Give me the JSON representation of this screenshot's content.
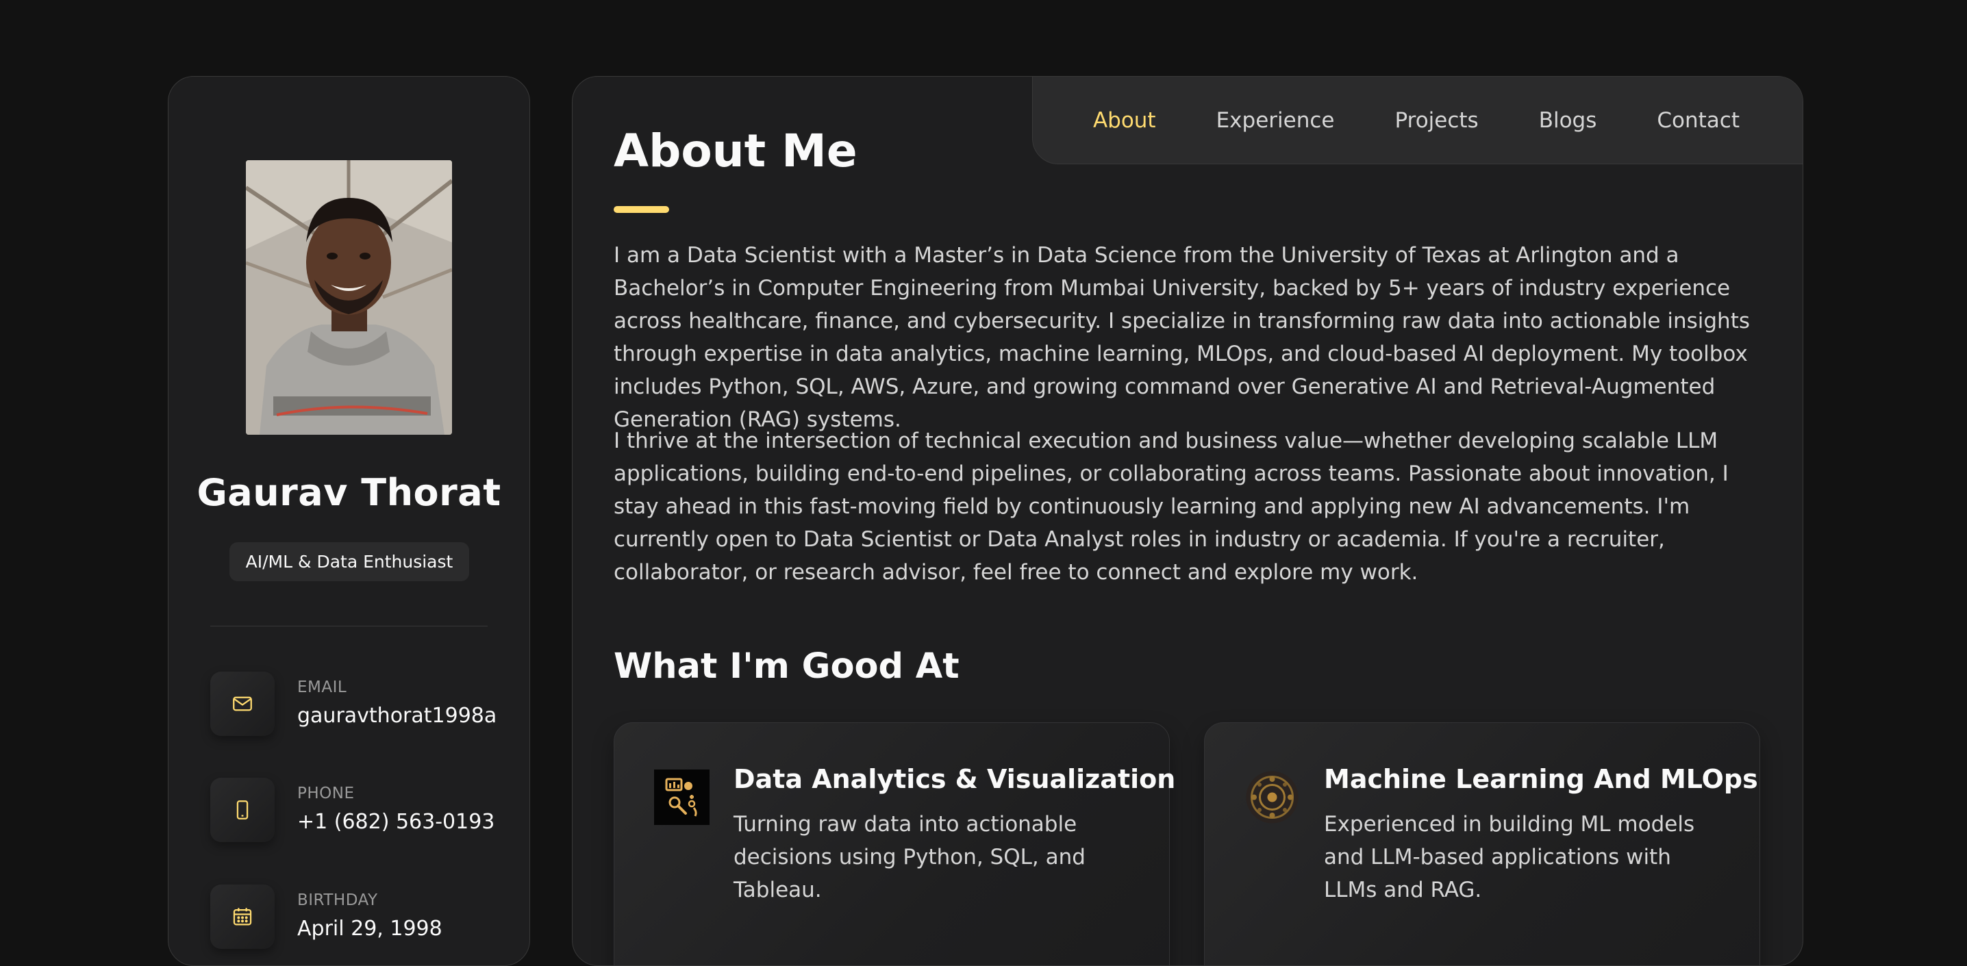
{
  "colors": {
    "background": "#121212",
    "panel": "#1e1e1f",
    "accent": "#ffdb70",
    "text": "#fafafa",
    "muted": "#d6d6d6"
  },
  "sidebar": {
    "name": "Gaurav Thorat",
    "title": "AI/ML & Data Enthusiast",
    "contacts": [
      {
        "label": "Email",
        "value": "gauravthorat1998a",
        "icon": "mail-icon"
      },
      {
        "label": "Phone",
        "value": "+1 (682) 563-0193",
        "icon": "phone-icon"
      },
      {
        "label": "Birthday",
        "value": "April 29, 1998",
        "icon": "calendar-icon"
      }
    ]
  },
  "navbar": {
    "items": [
      {
        "label": "About",
        "active": true
      },
      {
        "label": "Experience",
        "active": false
      },
      {
        "label": "Projects",
        "active": false
      },
      {
        "label": "Blogs",
        "active": false
      },
      {
        "label": "Contact",
        "active": false
      }
    ]
  },
  "about": {
    "title": "About Me",
    "paragraphs": [
      "I am a Data Scientist with a Master’s in Data Science from the University of Texas at Arlington and a Bachelor’s in Computer Engineering from Mumbai University, backed by 5+ years of industry experience across healthcare, finance, and cybersecurity. I specialize in transforming raw data into actionable insights through expertise in data analytics, machine learning, MLOps, and cloud-based AI deployment. My toolbox includes Python, SQL, AWS, Azure, and growing command over Generative AI and Retrieval-Augmented Generation (RAG) systems.",
      "I thrive at the intersection of technical execution and business value—whether developing scalable LLM applications, building end-to-end pipelines, or collaborating across teams. Passionate about innovation, I stay ahead in this fast-moving field by continuously learning and applying new AI advancements. I'm currently open to Data Scientist or Data Analyst roles in industry or academia. If you're a recruiter, collaborator, or research advisor, feel free to connect and explore my work."
    ]
  },
  "services": {
    "title": "What I'm Good At",
    "items": [
      {
        "title": "Data Analytics & Visualization",
        "text": "Turning raw data into actionable decisions using Python, SQL, and Tableau.",
        "icon": "data-analytics-icon"
      },
      {
        "title": "Machine Learning And MLOps",
        "text": "Experienced in building ML models and LLM-based applications with LLMs and RAG.",
        "icon": "machine-learning-icon"
      }
    ]
  }
}
